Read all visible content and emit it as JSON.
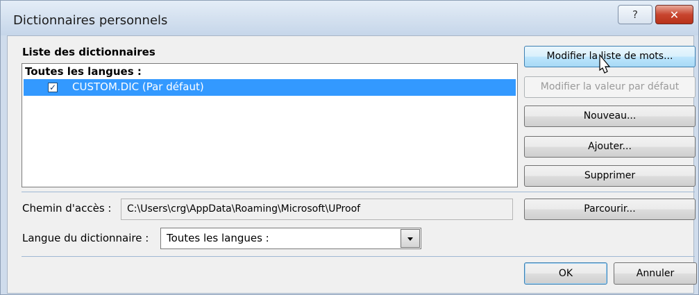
{
  "window": {
    "title": "Dictionnaires personnels",
    "help_glyph": "?",
    "close_glyph": "✕"
  },
  "dictionary_list": {
    "group_label": "Liste des dictionnaires",
    "header": "Toutes les langues :",
    "items": [
      {
        "checked": true,
        "check_glyph": "✓",
        "label": "CUSTOM.DIC (Par défaut)",
        "selected": true
      }
    ]
  },
  "buttons": {
    "edit_word_list": "Modifier la liste de mots...",
    "change_default": "Modifier la valeur par défaut",
    "new": "Nouveau...",
    "add": "Ajouter...",
    "remove": "Supprimer",
    "browse": "Parcourir...",
    "ok": "OK",
    "cancel": "Annuler"
  },
  "path": {
    "label": "Chemin d'accès :",
    "value": "C:\\Users\\crg\\AppData\\Roaming\\Microsoft\\UProof"
  },
  "language": {
    "label": "Langue du dictionnaire :",
    "value": "Toutes les langues :"
  },
  "colors": {
    "selection": "#3399ff",
    "title_bar": "#d3e0ef",
    "close_button": "#c8452f"
  }
}
